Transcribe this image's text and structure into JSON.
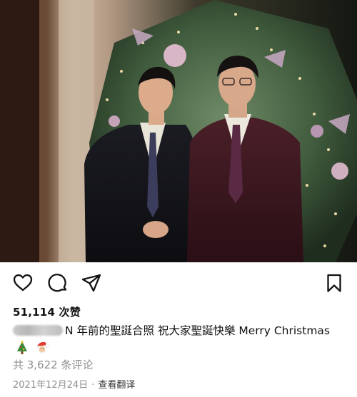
{
  "post": {
    "photo": {
      "description_icon": "photo-image"
    },
    "actions": {
      "like_icon": "heart-icon",
      "comment_icon": "comment-icon",
      "share_icon": "paper-plane-icon",
      "save_icon": "bookmark-icon"
    },
    "likes_text": "51,114 次赞",
    "caption": {
      "username": "",
      "text_line": "N 年前的聖誕合照 祝大家聖誕快樂 Merry Christmas",
      "emojis": [
        "christmas-tree",
        "santa-face"
      ]
    },
    "comments_link": "共 3,622 条评论",
    "date": "2021年12月24日",
    "separator": "·",
    "translate_link": "查看翻译"
  },
  "colors": {
    "text": "#111111",
    "muted": "#8e8e8e",
    "background": "#ffffff"
  }
}
